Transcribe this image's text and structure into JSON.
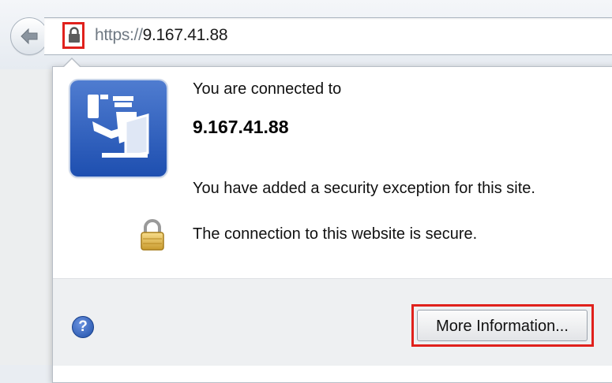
{
  "toolbar": {
    "url_scheme": "https://",
    "url_host": "9.167.41.88"
  },
  "identity_popup": {
    "connected_label": "You are connected to",
    "host": "9.167.41.88",
    "exception_text": "You have added a security exception for this site.",
    "secure_text": "The connection to this website is secure.",
    "help_glyph": "?",
    "more_info_label": "More Information..."
  },
  "icons": {
    "back": "back-arrow-icon",
    "identity": "padlock-icon",
    "site_identity": "passport-control-icon",
    "secure": "gold-padlock-icon",
    "help": "help-icon"
  },
  "colors": {
    "highlight": "#e0211c",
    "identity_icon_blue": "#1e4fb0",
    "url_scheme": "#6f7983"
  }
}
